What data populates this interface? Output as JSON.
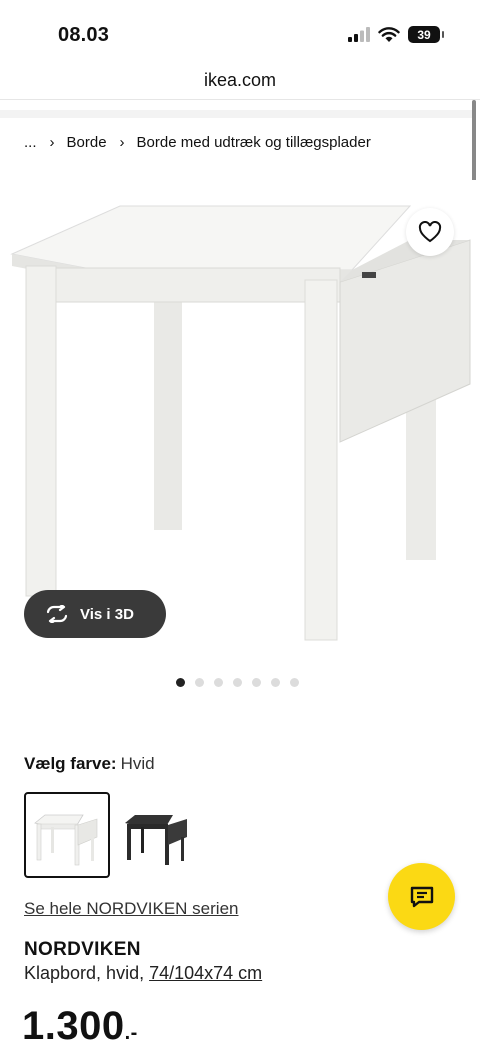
{
  "status_bar": {
    "time": "08.03",
    "battery": "39",
    "icons": [
      "signal-icon",
      "wifi-icon",
      "battery-icon"
    ]
  },
  "browser": {
    "url": "ikea.com"
  },
  "breadcrumb": {
    "items": [
      "...",
      "Borde",
      "Borde med udtræk og tillægsplader"
    ]
  },
  "gallery": {
    "view_3d_label": "Vis i 3D",
    "total_images": 7,
    "active_index": 0
  },
  "color_picker": {
    "label": "Vælg farve:",
    "selected": "Hvid",
    "options": [
      "white-table",
      "black-table"
    ]
  },
  "series_link": "Se hele NORDVIKEN serien",
  "product": {
    "name": "NORDVIKEN",
    "desc_prefix": "Klapbord, hvid, ",
    "dimensions": "74/104x74 cm",
    "price": "1.300",
    "price_suffix": ".-"
  },
  "colors": {
    "chat_button": "#fbd914",
    "view_3d_bg": "#3a3a3a"
  }
}
